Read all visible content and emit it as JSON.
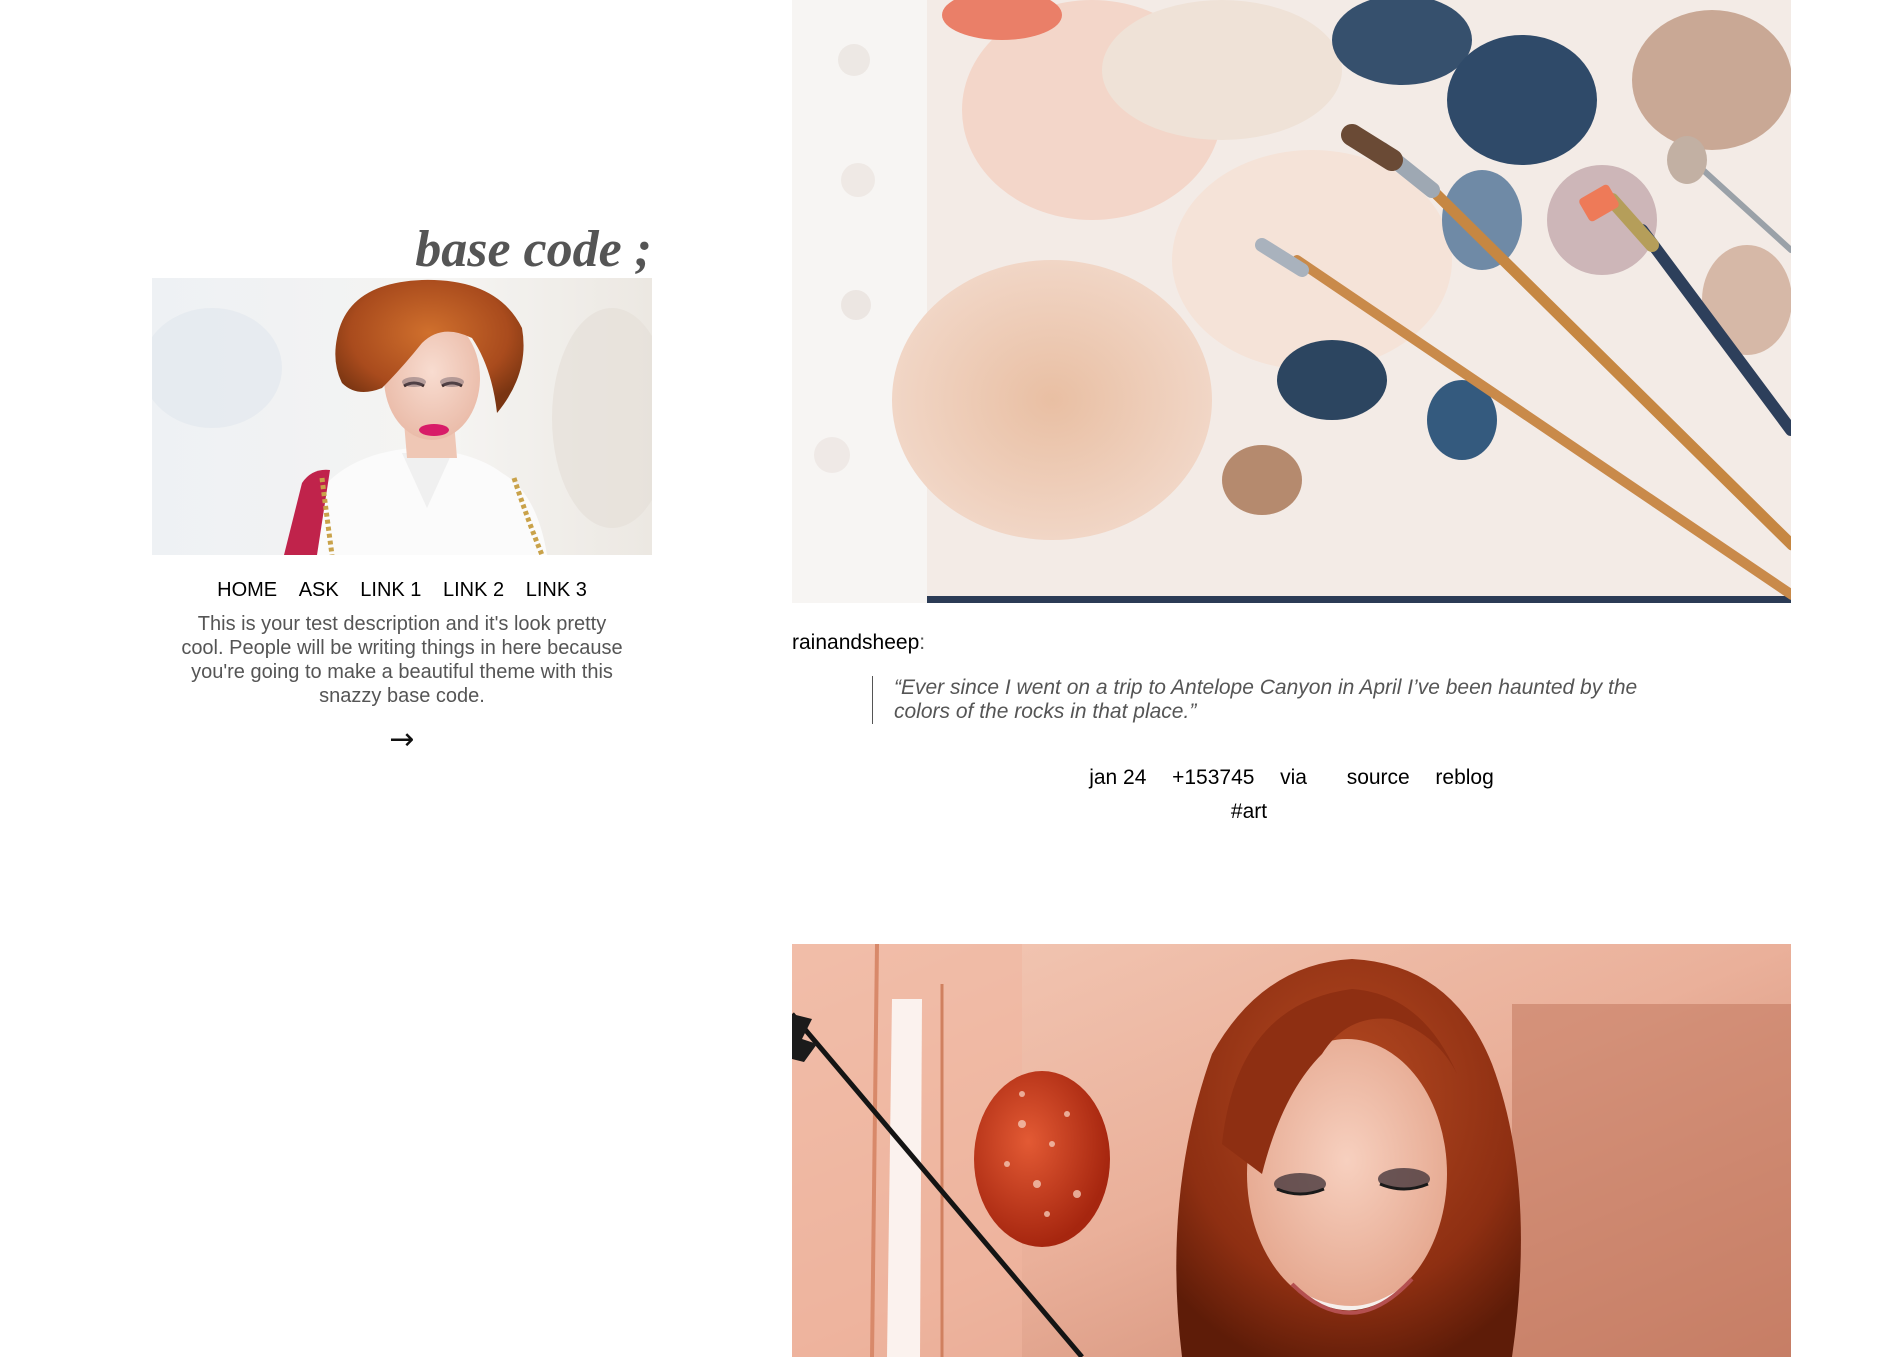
{
  "sidebar": {
    "title": "base code ;",
    "nav": [
      "HOME",
      "ASK",
      "LINK 1",
      "LINK 2",
      "LINK 3"
    ],
    "description": "This is your test description and it's look pretty cool. People will be writing things in here because you're going to make a beautiful theme with this snazzy base code.",
    "next_arrow": "→"
  },
  "posts": [
    {
      "type": "photo",
      "reblogger": "rainandsheep",
      "reblogger_colon": ":",
      "quote": "“Ever since I went on a trip to Antelope Canyon in April I’ve been haunted by the colors of the rocks in that place.”",
      "date": "jan 24",
      "notes": "+153745",
      "via": "via",
      "source": "source",
      "reblog": "reblog",
      "tags": [
        "#art"
      ]
    },
    {
      "type": "photo"
    }
  ],
  "colors": {
    "title": "#555555",
    "description": "#555555",
    "quote": "#555555",
    "link": "#000000",
    "background": "#ffffff"
  },
  "icons": {
    "pager": "right-arrow-icon"
  }
}
